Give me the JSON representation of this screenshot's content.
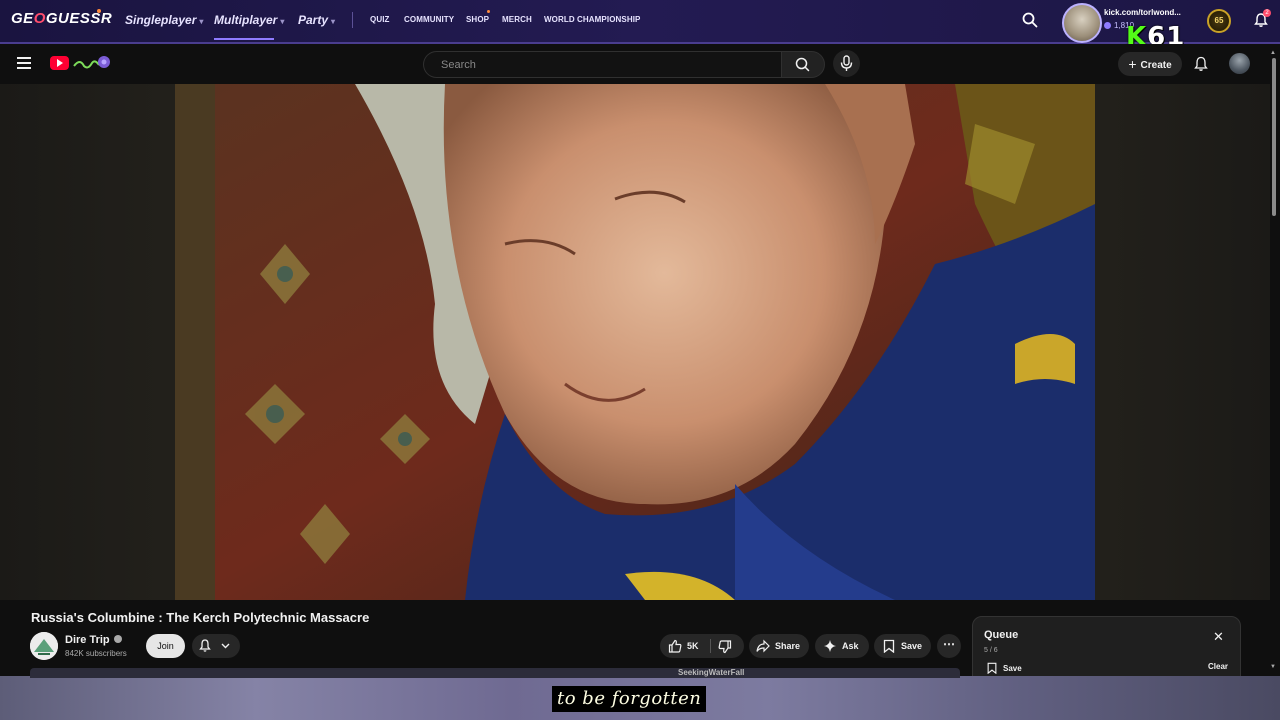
{
  "geoguessr": {
    "logo_pre": "GE",
    "logo_accent": "O",
    "logo_post": "GUESSR",
    "nav": {
      "singleplayer": "Singleplayer",
      "multiplayer": "Multiplayer",
      "party": "Party"
    },
    "links": {
      "quiz": "QUIZ",
      "community": "COMMUNITY",
      "shop": "SHOP",
      "merch": "MERCH",
      "world_championship": "WORLD CHAMPIONSHIP"
    },
    "user": {
      "name": "kick.com/torlwond...",
      "coins": "1,810",
      "level": "65",
      "notifications": "2"
    },
    "accent_color": "#8f7bff"
  },
  "kick_overlay": {
    "letter": "K",
    "number": "61",
    "color": "#53fc18"
  },
  "youtube": {
    "search_placeholder": "Search",
    "create_label": "Create"
  },
  "video": {
    "title": "Russia's Columbine : The Kerch Polytechnic Massacre",
    "channel": "Dire Trip",
    "subscribers": "842K subscribers",
    "join_label": "Join",
    "likes": "5K",
    "share_label": "Share",
    "ask_label": "Ask",
    "save_label": "Save",
    "subtitle": "to be forgotten"
  },
  "queue": {
    "title": "Queue",
    "count": "5 / 6",
    "save_label": "Save",
    "clear_label": "Clear"
  },
  "bottom_strip": {
    "text": "SeekingWaterFall"
  }
}
